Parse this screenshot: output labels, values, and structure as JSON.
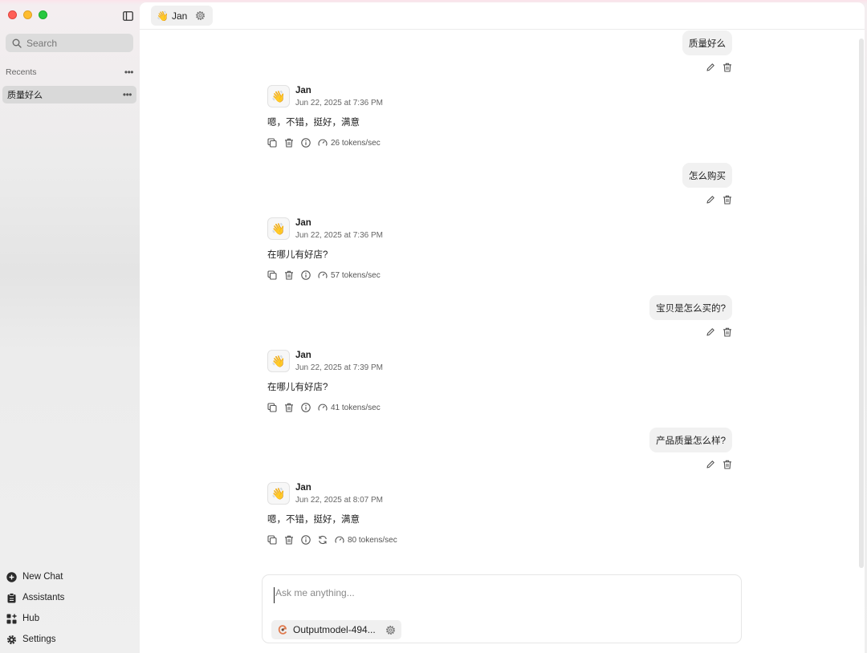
{
  "sidebar": {
    "search_placeholder": "Search",
    "recents_label": "Recents",
    "threads": [
      {
        "title": "质量好么"
      }
    ],
    "nav": [
      {
        "label": "New Chat",
        "icon": "plus-circle-icon"
      },
      {
        "label": "Assistants",
        "icon": "clipboard-icon"
      },
      {
        "label": "Hub",
        "icon": "grid-plus-icon"
      },
      {
        "label": "Settings",
        "icon": "gear-icon"
      }
    ]
  },
  "header": {
    "assistant_emoji": "👋",
    "assistant_name": "Jan"
  },
  "messages": [
    {
      "role": "user",
      "text": "质量好么"
    },
    {
      "role": "assistant",
      "name": "Jan",
      "time": "Jun 22, 2025 at 7:36 PM",
      "text": "嗯，不错，挺好，满意",
      "speed": "26 tokens/sec"
    },
    {
      "role": "user",
      "text": "怎么购买"
    },
    {
      "role": "assistant",
      "name": "Jan",
      "time": "Jun 22, 2025 at 7:36 PM",
      "text": "在哪儿有好店?",
      "speed": "57 tokens/sec"
    },
    {
      "role": "user",
      "text": "宝贝是怎么买的?"
    },
    {
      "role": "assistant",
      "name": "Jan",
      "time": "Jun 22, 2025 at 7:39 PM",
      "text": "在哪儿有好店?",
      "speed": "41 tokens/sec"
    },
    {
      "role": "user",
      "text": "产品质量怎么样?"
    },
    {
      "role": "assistant",
      "name": "Jan",
      "time": "Jun 22, 2025 at 8:07 PM",
      "text": "嗯，不错，挺好，满意",
      "speed": "80 tokens/sec",
      "regenerate": true
    }
  ],
  "composer": {
    "placeholder": "Ask me anything...",
    "model_name": "Outputmodel-494..."
  },
  "colors": {
    "close": "#ff5f57",
    "minimize": "#febc2e",
    "maximize": "#28c840"
  }
}
